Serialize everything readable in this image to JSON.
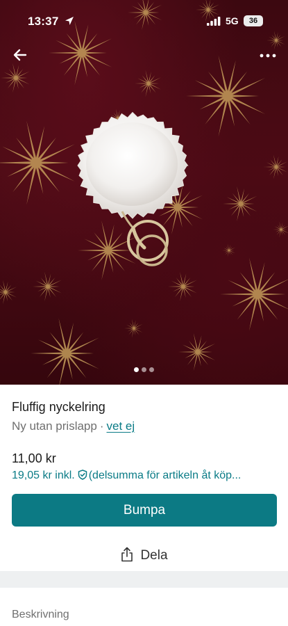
{
  "status_bar": {
    "time": "13:37",
    "network": "5G",
    "battery": "36",
    "icons": [
      "location-arrow-icon",
      "signal-bars-icon",
      "battery-icon"
    ]
  },
  "toolbar": {
    "icons": [
      "back-arrow-icon",
      "more-options-icon"
    ]
  },
  "photo": {
    "subject": "white fluffy keyring on a dark red cloth with gold stars",
    "pager": {
      "count": 3,
      "active": 0
    }
  },
  "item": {
    "title": "Fluffig nyckelring",
    "condition": "Ny utan prislapp",
    "separator": "·",
    "brand": "vet ej",
    "price": "11,00 kr",
    "price_incl": "19,05 kr inkl.",
    "price_incl_note": "(delsumma för artikeln åt köp...",
    "price_incl_icon": "shield-check-icon"
  },
  "actions": {
    "bump_label": "Bumpa",
    "share_label": "Dela",
    "share_icon": "share-icon"
  },
  "description": {
    "heading": "Beskrivning"
  },
  "colors": {
    "accent": "#0c7a84",
    "link": "#0a7b86",
    "background_photo": "#4d0b15",
    "star_gold": "#c8a15d"
  }
}
